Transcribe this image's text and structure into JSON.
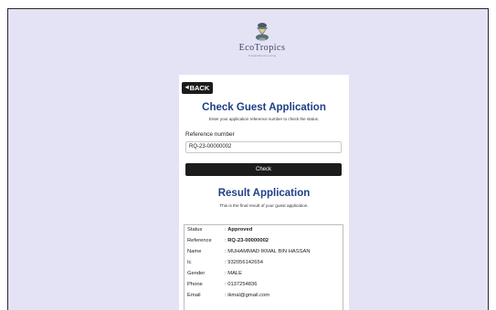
{
  "brand": {
    "name": "EcoTropics",
    "tagline": "Sustainable Eco Living"
  },
  "back_button": {
    "label": "BACK"
  },
  "check_section": {
    "title": "Check Guest Application",
    "subtitle": "Enter your application reference number to check the status.",
    "field_label": "Reference number",
    "reference_value": "RQ-23-00000002",
    "check_button": "Check"
  },
  "result_section": {
    "title": "Result Application",
    "subtitle": "This is the final result of your guest application.",
    "rows": [
      {
        "label": "Status",
        "value": "Approved",
        "bold": true
      },
      {
        "label": "Reference",
        "value": "RQ-23-00000002",
        "bold": true
      },
      {
        "label": "Name",
        "value": "MUHAMMAD IKMAL BIN HASSAN",
        "bold": false
      },
      {
        "label": "Ic",
        "value": "932056142654",
        "bold": false
      },
      {
        "label": "Gender",
        "value": "MALE",
        "bold": false
      },
      {
        "label": "Phone",
        "value": "0137254836",
        "bold": false
      },
      {
        "label": "Email",
        "value": "ikmal@gmail.com",
        "bold": false
      }
    ]
  },
  "colors": {
    "background": "#e4e3f5",
    "heading": "#1f3f86",
    "button": "#1c1c1c"
  }
}
